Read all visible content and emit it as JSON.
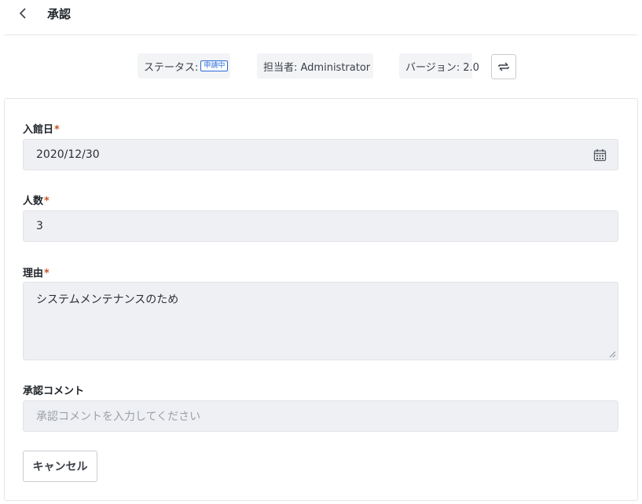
{
  "header": {
    "title": "承認",
    "back_icon": "chevron-left-icon"
  },
  "meta": {
    "status_label": "ステータス:",
    "status_badge": "申請中",
    "assignee": "担当者: Administrator",
    "version": "バージョン: 2.0",
    "swap_icon": "swap-arrows-icon"
  },
  "form": {
    "entry_date": {
      "label": "入館日",
      "required": "*",
      "value": "2020/12/30",
      "icon": "calendar-icon"
    },
    "people": {
      "label": "人数",
      "required": "*",
      "value": "3"
    },
    "reason": {
      "label": "理由",
      "required": "*",
      "value": "システムメンテナンスのため"
    },
    "comment": {
      "label": "承認コメント",
      "placeholder": "承認コメントを入力してください"
    }
  },
  "actions": {
    "cancel": "キャンセル"
  },
  "colors": {
    "accent": "#2a6ad8",
    "required": "#c0592a",
    "field_bg": "#eff0f3"
  }
}
